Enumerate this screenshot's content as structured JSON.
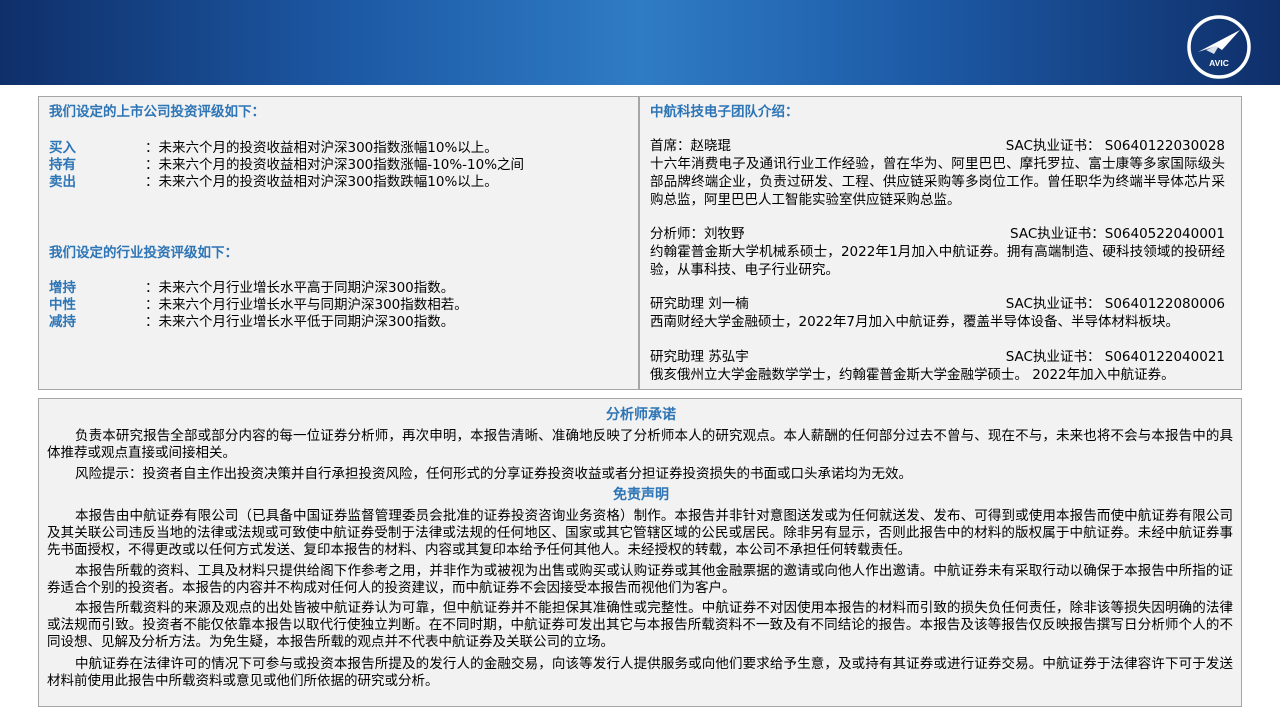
{
  "header": {
    "logo": {
      "icon": "avic-logo-icon",
      "text": "AVIC"
    }
  },
  "stock_rating": {
    "title": "我们设定的上市公司投资评级如下：",
    "items": [
      {
        "name": "买入",
        "desc": "：未来六个月的投资收益相对沪深300指数涨幅10%以上。"
      },
      {
        "name": "持有",
        "desc": "：未来六个月的投资收益相对沪深300指数涨幅-10%-10%之间"
      },
      {
        "name": "卖出",
        "desc": "：未来六个月的投资收益相对沪深300指数跌幅10%以上。"
      }
    ]
  },
  "industry_rating": {
    "title": "我们设定的行业投资评级如下：",
    "items": [
      {
        "name": "增持",
        "desc": "：未来六个月行业增长水平高于同期沪深300指数。"
      },
      {
        "name": "中性",
        "desc": "：未来六个月行业增长水平与同期沪深300指数相若。"
      },
      {
        "name": "减持",
        "desc": "：未来六个月行业增长水平低于同期沪深300指数。"
      }
    ]
  },
  "team": {
    "title": "中航科技电子团队介绍：",
    "members": [
      {
        "name": "首席：赵晓琨",
        "cert": "SAC执业证书： S0640122030028",
        "desc": "十六年消费电子及通讯行业工作经验，曾在华为、阿里巴巴、摩托罗拉、富士康等多家国际级头部品牌终端企业，负责过研发、工程、供应链采购等多岗位工作。曾任职华为终端半导体芯片采购总监，阿里巴巴人工智能实验室供应链采购总监。"
      },
      {
        "name": "分析师：刘牧野",
        "cert": "SAC执业证书：S0640522040001",
        "desc": "约翰霍普金斯大学机械系硕士，2022年1月加入中航证券。拥有高端制造、硬科技领域的投研经验，从事科技、电子行业研究。"
      },
      {
        "name": "研究助理 刘一楠",
        "cert": "SAC执业证书： S0640122080006",
        "desc": "西南财经大学金融硕士，2022年7月加入中航证券，覆盖半导体设备、半导体材料板块。"
      },
      {
        "name": "研究助理 苏弘宇",
        "cert": "SAC执业证书： S0640122040021",
        "desc": "俄亥俄州立大学金融数学学士，约翰霍普金斯大学金融学硕士。 2022年加入中航证券。"
      }
    ]
  },
  "commitment": {
    "title": "分析师承诺",
    "paragraphs": [
      "负责本研究报告全部或部分内容的每一位证券分析师，再次申明，本报告清晰、准确地反映了分析师本人的研究观点。本人薪酬的任何部分过去不曾与、现在不与，未来也将不会与本报告中的具体推荐或观点直接或间接相关。",
      "风险提示：投资者自主作出投资决策并自行承担投资风险，任何形式的分享证券投资收益或者分担证券投资损失的书面或口头承诺均为无效。"
    ]
  },
  "disclaimer": {
    "title": "免责声明",
    "paragraphs": [
      "本报告由中航证券有限公司（已具备中国证券监督管理委员会批准的证券投资咨询业务资格）制作。本报告并非针对意图送发或为任何就送发、发布、可得到或使用本报告而使中航证券有限公司及其关联公司违反当地的法律或法规或可致使中航证券受制于法律或法规的任何地区、国家或其它管辖区域的公民或居民。除非另有显示，否则此报告中的材料的版权属于中航证券。未经中航证券事先书面授权，不得更改或以任何方式发送、复印本报告的材料、内容或其复印本给予任何其他人。未经授权的转载，本公司不承担任何转载责任。",
      "本报告所载的资料、工具及材料只提供给阁下作参考之用，并非作为或被视为出售或购买或认购证券或其他金融票据的邀请或向他人作出邀请。中航证券未有采取行动以确保于本报告中所指的证券适合个别的投资者。本报告的内容并不构成对任何人的投资建议，而中航证券不会因接受本报告而视他们为客户。",
      "本报告所载资料的来源及观点的出处皆被中航证券认为可靠，但中航证券并不能担保其准确性或完整性。中航证券不对因使用本报告的材料而引致的损失负任何责任，除非该等损失因明确的法律或法规而引致。投资者不能仅依靠本报告以取代行使独立判断。在不同时期，中航证券可发出其它与本报告所载资料不一致及有不同结论的报告。本报告及该等报告仅反映报告撰写日分析师个人的不同设想、见解及分析方法。为免生疑，本报告所载的观点并不代表中航证券及关联公司的立场。",
      "中航证券在法律许可的情况下可参与或投资本报告所提及的发行人的金融交易，向该等发行人提供服务或向他们要求给予生意，及或持有其证券或进行证券交易。中航证券于法律容许下可于发送材料前使用此报告中所载资料或意见或他们所依据的研究或分析。"
    ]
  }
}
